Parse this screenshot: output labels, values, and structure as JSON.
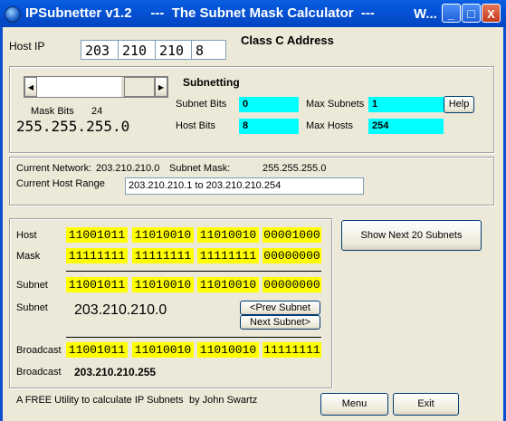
{
  "window": {
    "title": "IPSubnetter v1.2     ---  The Subnet Mask Calculator  ---",
    "title_trunc": "W...",
    "minimize": "_",
    "maximize": "□",
    "close": "X"
  },
  "host_ip": {
    "label": "Host IP",
    "octets": [
      "203",
      "210",
      "210",
      "8"
    ],
    "class_label": "Class C Address"
  },
  "slider": {
    "mask_bits_label": "Mask Bits",
    "mask_bits": "24",
    "mask": "255.255.255.0",
    "left_arrow": "◀",
    "right_arrow": "▶"
  },
  "subnetting": {
    "title": "Subnetting",
    "subnet_bits_label": "Subnet Bits",
    "subnet_bits": "0",
    "max_subnets_label": "Max Subnets",
    "max_subnets": "1",
    "host_bits_label": "Host Bits",
    "host_bits": "8",
    "max_hosts_label": "Max Hosts",
    "max_hosts": "254",
    "help_button": "Help"
  },
  "network": {
    "current_network_label": "Current Network:",
    "current_network": "203.210.210.0",
    "subnet_mask_label": "Subnet Mask:",
    "subnet_mask": "255.255.255.0",
    "host_range_label": "Current Host Range",
    "host_range": "203.210.210.1 to 203.210.210.254"
  },
  "binary": {
    "host_label": "Host",
    "host": [
      "11001011",
      "11010010",
      "11010010",
      "00001000"
    ],
    "mask_label": "Mask",
    "mask": [
      "11111111",
      "11111111",
      "11111111",
      "00000000"
    ],
    "subnet_label": "Subnet",
    "subnet": [
      "11001011",
      "11010010",
      "11010010",
      "00000000"
    ],
    "subnet_dec_label": "Subnet",
    "subnet_dec": "203.210.210.0",
    "prev_button": "<Prev Subnet",
    "next_button": "Next Subnet>",
    "broadcast_label": "Broadcast",
    "broadcast": [
      "11001011",
      "11010010",
      "11010010",
      "11111111"
    ],
    "broadcast_dec_label": "Broadcast",
    "broadcast_dec": "203.210.210.255"
  },
  "show_next_button": "Show Next 20 Subnets",
  "footer": {
    "text": "A FREE Utility to calculate IP Subnets",
    "author": "by John Swartz",
    "menu_button": "Menu",
    "exit_button": "Exit"
  }
}
